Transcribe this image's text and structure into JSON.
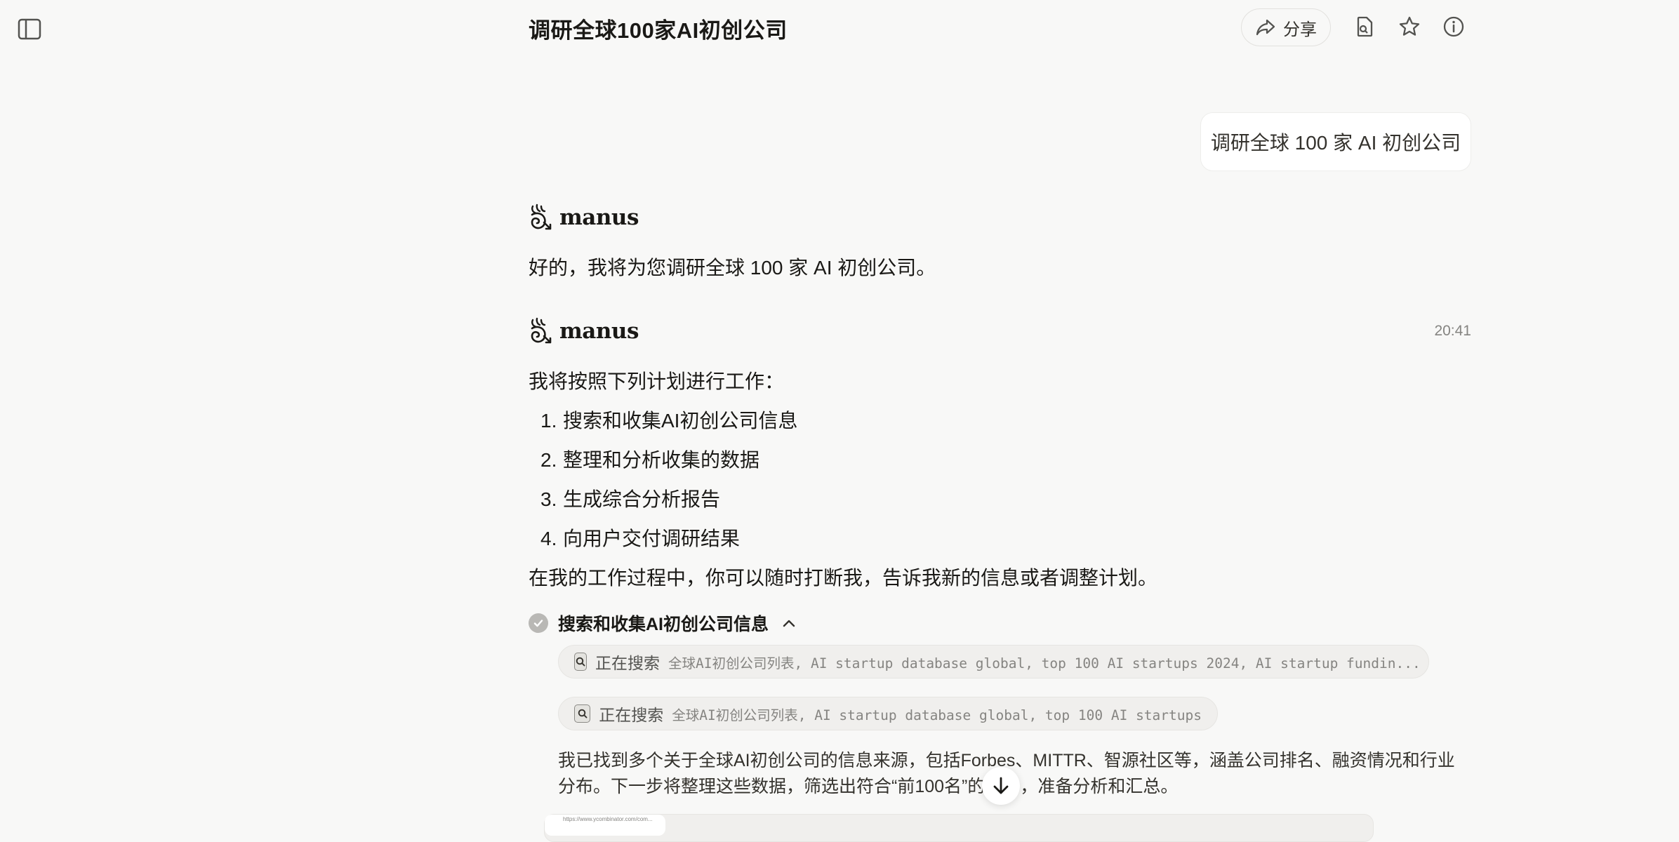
{
  "header": {
    "title": "调研全球100家AI初创公司",
    "share_label": "分享",
    "icons": [
      "sidebar-toggle-icon",
      "share-icon",
      "file-icon",
      "star-icon",
      "info-icon"
    ]
  },
  "user_message": "调研全球 100 家 AI 初创公司",
  "assistant_name": "manus",
  "messages": {
    "first": "好的，我将为您调研全球 100 家 AI 初创公司。",
    "timestamp": "20:41",
    "plan_intro": "我将按照下列计划进行工作：",
    "plan_items": [
      {
        "num": "1.",
        "text": "搜索和收集AI初创公司信息"
      },
      {
        "num": "2.",
        "text": "整理和分析收集的数据"
      },
      {
        "num": "3.",
        "text": "生成综合分析报告"
      },
      {
        "num": "4.",
        "text": "向用户交付调研结果"
      }
    ],
    "plan_outro": "在我的工作过程中，你可以随时打断我，告诉我新的信息或者调整计划。"
  },
  "task": {
    "label": "搜索和收集AI初创公司信息",
    "searches": [
      {
        "action": "正在搜索",
        "query": "全球AI初创公司列表, AI startup database global, top 100 AI startups 2024, AI startup fundin..."
      },
      {
        "action": "正在搜索",
        "query": "全球AI初创公司列表, AI startup database global, top 100 AI startups"
      }
    ],
    "summary": "我已找到多个关于全球AI初创公司的信息来源，包括Forbes、MITTR、智源社区等，涵盖公司排名、融资情况和行业分布。下一步将整理这些数据，筛选出符合“前100名”的公司，准备分析和汇总。",
    "preview_url": "https://www.ycombinator.com/com..."
  }
}
